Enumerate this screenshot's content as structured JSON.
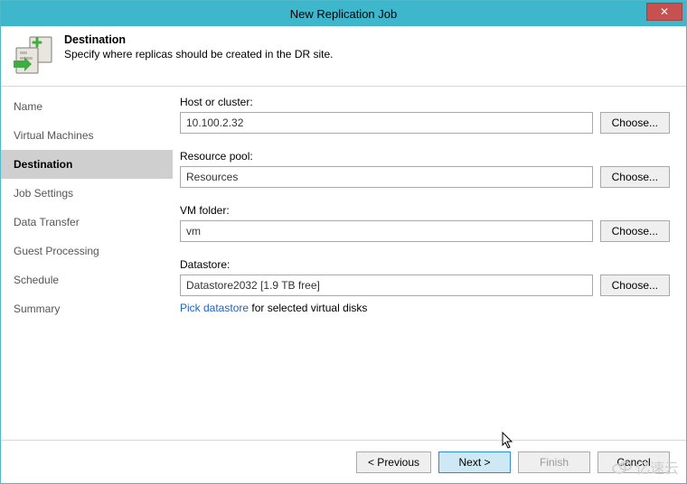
{
  "window": {
    "title": "New Replication Job"
  },
  "header": {
    "title": "Destination",
    "subtitle": "Specify where replicas should be created in the DR site."
  },
  "sidebar": {
    "items": [
      {
        "label": "Name",
        "active": false
      },
      {
        "label": "Virtual Machines",
        "active": false
      },
      {
        "label": "Destination",
        "active": true
      },
      {
        "label": "Job Settings",
        "active": false
      },
      {
        "label": "Data Transfer",
        "active": false
      },
      {
        "label": "Guest Processing",
        "active": false
      },
      {
        "label": "Schedule",
        "active": false
      },
      {
        "label": "Summary",
        "active": false
      }
    ]
  },
  "fields": {
    "host": {
      "label": "Host or cluster:",
      "value": "10.100.2.32",
      "choose": "Choose..."
    },
    "pool": {
      "label": "Resource pool:",
      "value": "Resources",
      "choose": "Choose..."
    },
    "folder": {
      "label": "VM folder:",
      "value": "vm",
      "choose": "Choose..."
    },
    "datastore": {
      "label": "Datastore:",
      "value": "Datastore2032 [1.9 TB free]",
      "choose": "Choose...",
      "link": "Pick datastore",
      "hint": " for selected virtual disks"
    }
  },
  "footer": {
    "previous": "< Previous",
    "next": "Next >",
    "finish": "Finish",
    "cancel": "Cancel"
  },
  "watermark": "亿速云"
}
